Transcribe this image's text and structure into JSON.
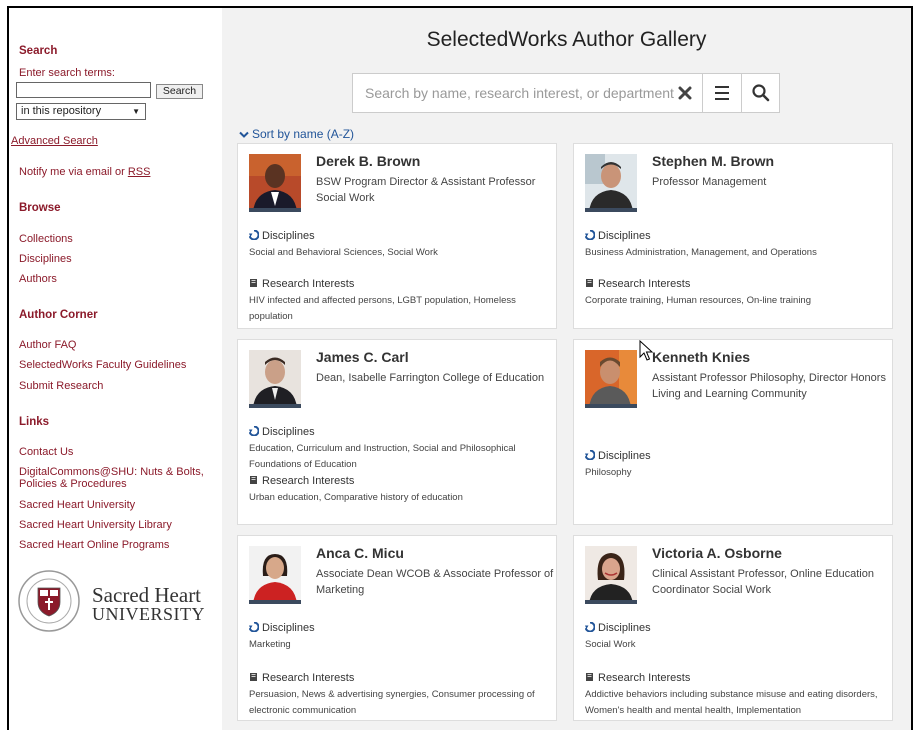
{
  "sidebar": {
    "search_heading": "Search",
    "search_label": "Enter search terms:",
    "search_input_value": "",
    "search_button": "Search",
    "scope_selected": "in this repository",
    "advanced_search": "Advanced Search",
    "notify_prefix": "Notify me via email or ",
    "notify_rss": "RSS",
    "browse_heading": "Browse",
    "browse_links": [
      "Collections",
      "Disciplines",
      "Authors"
    ],
    "author_corner_heading": "Author Corner",
    "author_corner_links": [
      "Author FAQ",
      "SelectedWorks Faculty Guidelines",
      "Submit Research"
    ],
    "links_heading": "Links",
    "links": [
      "Contact Us",
      "DigitalCommons@SHU: Nuts & Bolts,",
      "Policies & Procedures",
      "Sacred Heart University",
      "Sacred Heart University Library",
      "Sacred Heart Online Programs"
    ],
    "logo_line1": "Sacred Heart",
    "logo_line2": "UNIVERSITY"
  },
  "main": {
    "title": "SelectedWorks Author Gallery",
    "search_placeholder": "Search by name, research interest, or department",
    "sort_label": "Sort by name (A-Z)",
    "disciplines_label": "Disciplines",
    "research_label": "Research Interests"
  },
  "authors": [
    {
      "name": "Derek B. Brown",
      "title": "BSW Program Director & Assistant Professor Social Work",
      "disciplines": "Social and Behavioral Sciences, Social Work",
      "research": "HIV infected and affected persons, LGBT population, Homeless population"
    },
    {
      "name": "Stephen M. Brown",
      "title": "Professor Management",
      "disciplines": "Business Administration, Management, and Operations",
      "research": "Corporate training, Human resources, On-line training"
    },
    {
      "name": "James C. Carl",
      "title": "Dean, Isabelle Farrington College of Education",
      "disciplines": "Education, Curriculum and Instruction, Social and Philosophical Foundations of Education",
      "research": "Urban education, Comparative history of education"
    },
    {
      "name": "Kenneth Knies",
      "title": "Assistant Professor Philosophy, Director Honors Living and Learning Community",
      "disciplines": "Philosophy"
    },
    {
      "name": "Anca C. Micu",
      "title": "Associate Dean WCOB & Associate Professor of Marketing",
      "disciplines": "Marketing",
      "research": "Persuasion, News & advertising synergies, Consumer processing of electronic communication"
    },
    {
      "name": "Victoria A. Osborne",
      "title": "Clinical Assistant Professor, Online Education Coordinator Social Work",
      "disciplines": "Social Work",
      "research": "Addictive behaviors including substance misuse and eating disorders, Women's health and mental health, Implementation"
    }
  ],
  "colors": {
    "sidebar_link": "#8b1a2a",
    "main_bg": "#f2f2f2",
    "sort_link": "#225599"
  }
}
